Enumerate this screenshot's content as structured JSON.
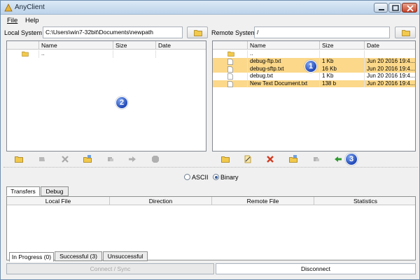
{
  "window": {
    "title": "AnyClient"
  },
  "menu": {
    "file": "File",
    "help": "Help"
  },
  "local": {
    "label": "Local System",
    "path": "C:\\Users\\win7-32bit\\Documents\\newpath",
    "columns": [
      "Name",
      "Size",
      "Date"
    ],
    "rows": [
      {
        "name": "..",
        "size": "",
        "date": ""
      }
    ]
  },
  "remote": {
    "label": "Remote System",
    "path": "/",
    "columns": [
      "Name",
      "Size",
      "Date"
    ],
    "rows": [
      {
        "name": "..",
        "size": "",
        "date": "",
        "selected": false
      },
      {
        "name": "debug-ftp.txt",
        "size": "1 Kb",
        "date": "Jun 20 2016 19:4...",
        "selected": true
      },
      {
        "name": "debug-sftp.txt",
        "size": "16 Kb",
        "date": "Jun 20 2016 19:4...",
        "selected": true
      },
      {
        "name": "debug.txt",
        "size": "1 Kb",
        "date": "Jun 20 2016 19:4...",
        "selected": false
      },
      {
        "name": "New Text Document.txt",
        "size": "138 b",
        "date": "Jun 20 2016 19:4...",
        "selected": true
      }
    ]
  },
  "badges": {
    "one": "1",
    "two": "2",
    "three": "3"
  },
  "transfer_mode": {
    "ascii": "ASCII",
    "binary": "Binary",
    "selected": "binary"
  },
  "tabs": {
    "transfers": "Transfers",
    "debug": "Debug"
  },
  "transfer_columns": [
    "Local File",
    "Direction",
    "Remote File",
    "Statistics"
  ],
  "status_tabs": {
    "in_progress": "In Progress (0)",
    "successful": "Successful (3)",
    "unsuccessful": "Unsuccessful"
  },
  "buttons": {
    "connect_sync": "Connect / Sync",
    "disconnect": "Disconnect"
  },
  "colors": {
    "selection": "#fbd88a",
    "badge": "#2149b8",
    "delete": "#d23c23",
    "arrow": "#2f9a2f"
  }
}
